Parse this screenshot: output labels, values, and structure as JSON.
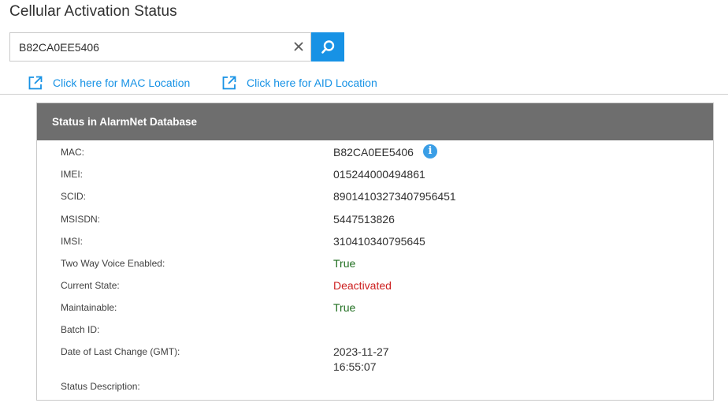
{
  "page": {
    "title": "Cellular Activation Status"
  },
  "search": {
    "value": "B82CA0EE5406"
  },
  "links": {
    "mac_location": "Click here for MAC Location",
    "aid_location": "Click here for AID Location"
  },
  "panel": {
    "header": "Status in AlarmNet Database",
    "rows": [
      {
        "label": "MAC:",
        "value": "B82CA0EE5406"
      },
      {
        "label": "IMEI:",
        "value": "015244000494861"
      },
      {
        "label": "SCID:",
        "value": "89014103273407956451"
      },
      {
        "label": "MSISDN:",
        "value": "5447513826"
      },
      {
        "label": "IMSI:",
        "value": "310410340795645"
      },
      {
        "label": "Two Way Voice Enabled:",
        "value": "True"
      },
      {
        "label": "Current State:",
        "value": "Deactivated"
      },
      {
        "label": "Maintainable:",
        "value": "True"
      },
      {
        "label": "Batch ID:",
        "value": ""
      },
      {
        "label": "Date of Last Change (GMT):",
        "value_line1": "2023-11-27",
        "value_line2": "16:55:07"
      },
      {
        "label": "Status Description:",
        "value": ""
      }
    ]
  },
  "colors": {
    "accent": "#1792e5",
    "header_bg": "#6e6e6e",
    "status_true": "#1f6e1f",
    "status_deactivated": "#cc1f1f"
  },
  "icons": {
    "search": "search-icon",
    "clear": "close-icon",
    "external_link": "external-link-icon",
    "info": "info-icon"
  }
}
